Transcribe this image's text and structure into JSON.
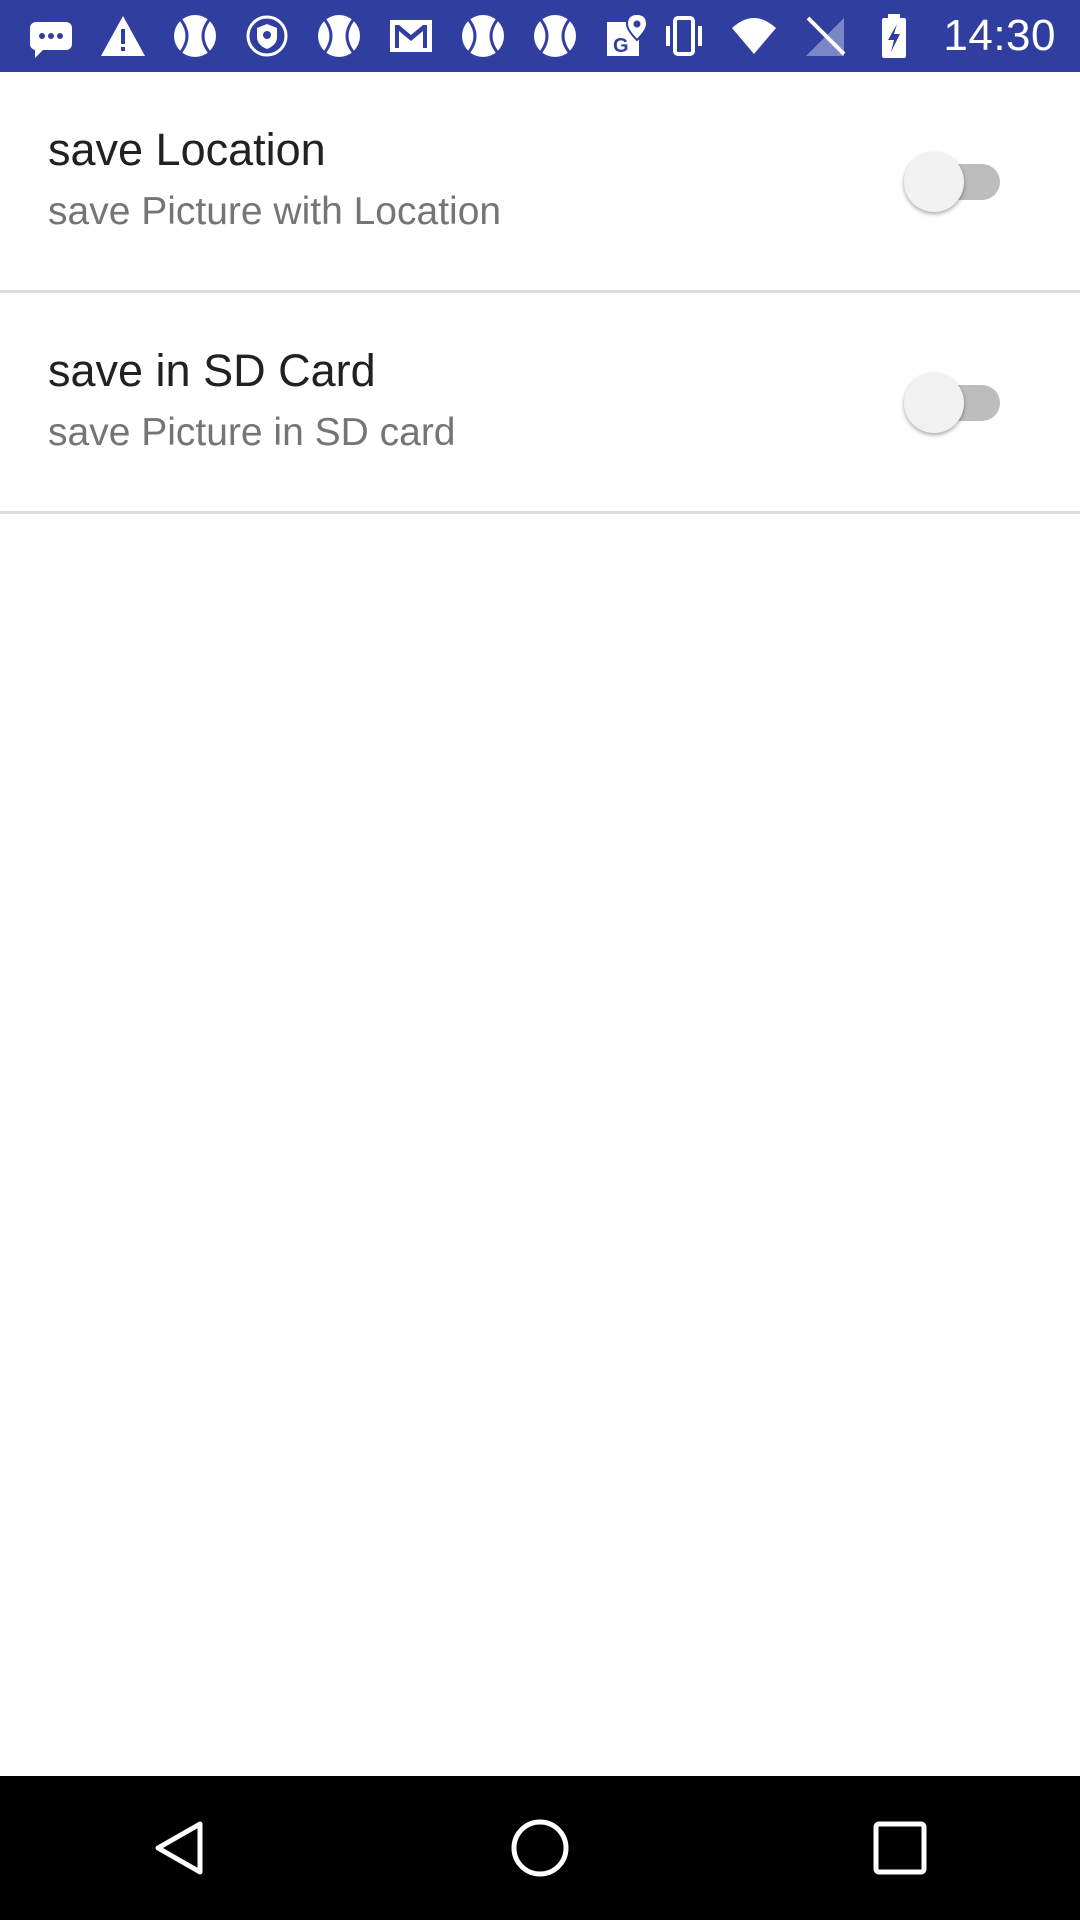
{
  "status_bar": {
    "time": "14:30",
    "background_color": "#303f9f",
    "left_icons": [
      "message-icon",
      "warning-icon",
      "baseball-icon",
      "vpn-shield-icon",
      "baseball-icon",
      "gmail-icon",
      "baseball-icon",
      "baseball-icon",
      "maps-icon"
    ],
    "right_icons": [
      "vibrate-icon",
      "wifi-icon",
      "no-signal-icon",
      "battery-charging-icon"
    ]
  },
  "preferences": [
    {
      "title": "save Location",
      "summary": "save Picture with Location",
      "checked": false
    },
    {
      "title": "save in SD Card",
      "summary": "save Picture in SD card",
      "checked": false
    }
  ],
  "nav_bar": {
    "buttons": [
      "back-icon",
      "home-icon",
      "recents-icon"
    ]
  }
}
